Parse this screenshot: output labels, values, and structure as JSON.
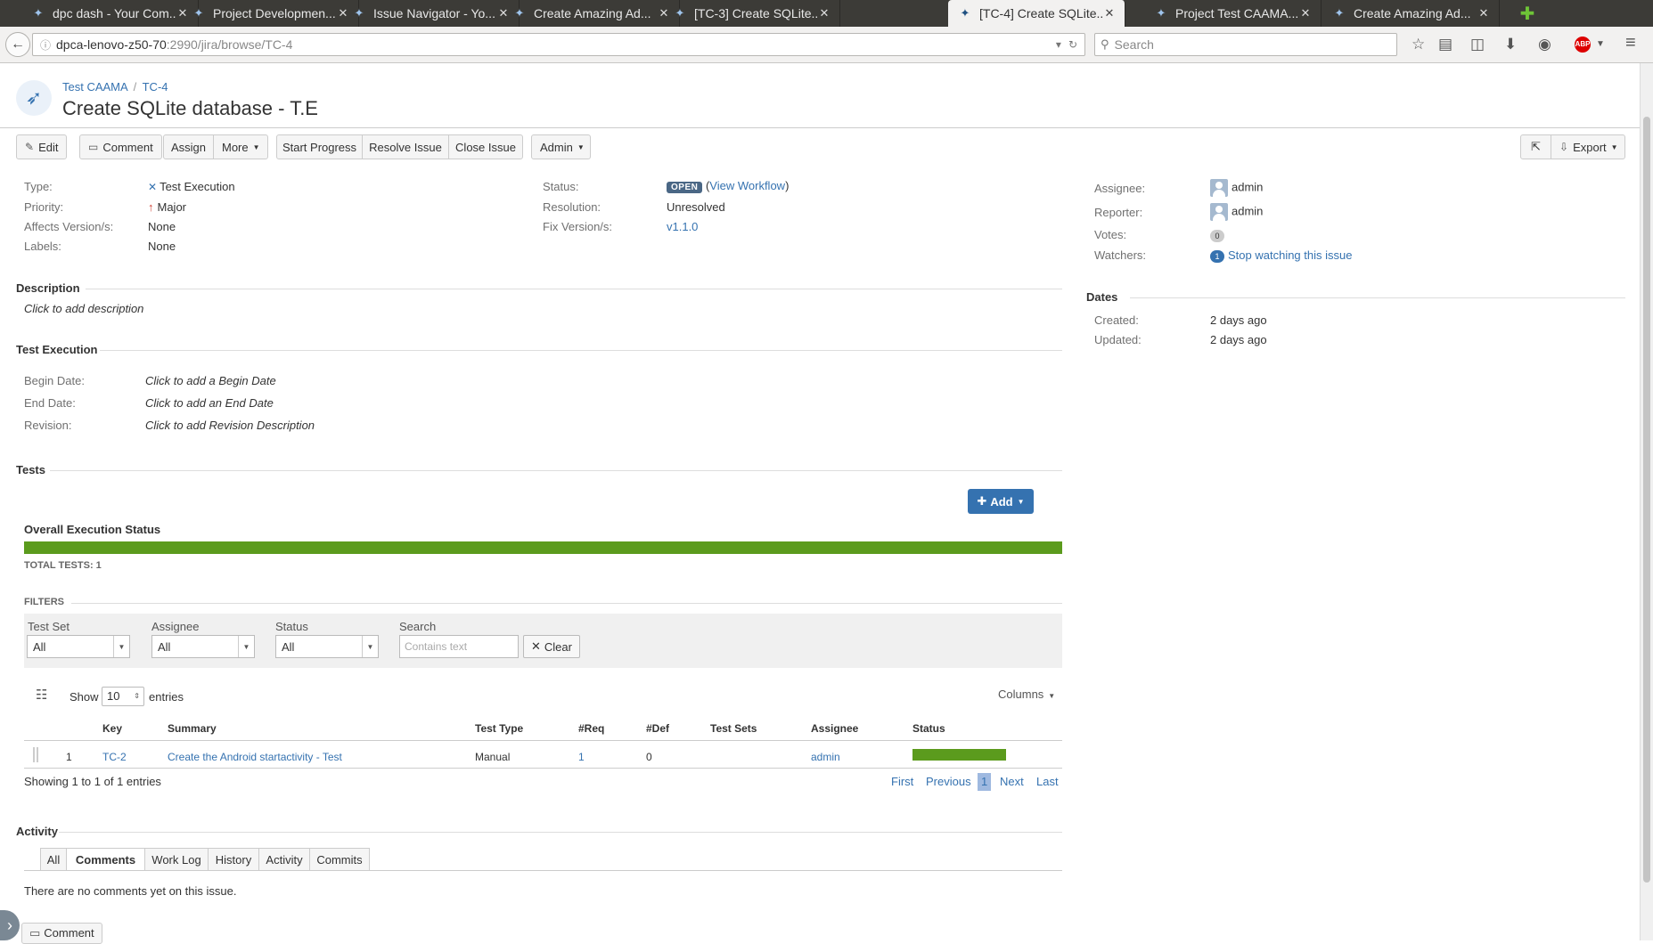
{
  "browser": {
    "tabs": [
      {
        "title": "dpc dash - Your Com..."
      },
      {
        "title": "Project Developmen..."
      },
      {
        "title": "Issue Navigator - Yo..."
      },
      {
        "title": "Create Amazing Ad..."
      },
      {
        "title": "[TC-3] Create SQLite..."
      },
      {
        "title": "[TC-4] Create SQLite...",
        "active": true
      },
      {
        "title": "Project Test CAAMA..."
      },
      {
        "title": "Create Amazing Ad..."
      }
    ],
    "url_host": "dpca-lenovo-z50-70",
    "url_path": ":2990/jira/browse/TC-4",
    "search_placeholder": "Search",
    "abp_label": "ABP"
  },
  "breadcrumb": {
    "project": "Test CAAMA",
    "separator": "/",
    "issue_key": "TC-4"
  },
  "issue": {
    "title": "Create SQLite database - T.E"
  },
  "toolbar": {
    "edit": "Edit",
    "comment": "Comment",
    "assign": "Assign",
    "more": "More",
    "start_progress": "Start Progress",
    "resolve": "Resolve Issue",
    "close": "Close Issue",
    "admin": "Admin",
    "export": "Export"
  },
  "details": {
    "type_label": "Type:",
    "type_value": "Test Execution",
    "priority_label": "Priority:",
    "priority_value": "Major",
    "affects_label": "Affects Version/s:",
    "affects_value": "None",
    "labels_label": "Labels:",
    "labels_value": "None",
    "status_label": "Status:",
    "status_value": "OPEN",
    "view_workflow": "View Workflow",
    "resolution_label": "Resolution:",
    "resolution_value": "Unresolved",
    "fix_label": "Fix Version/s:",
    "fix_value": "v1.1.0"
  },
  "people": {
    "assignee_label": "Assignee:",
    "assignee_value": "admin",
    "reporter_label": "Reporter:",
    "reporter_value": "admin",
    "votes_label": "Votes:",
    "votes_value": "0",
    "watchers_label": "Watchers:",
    "watchers_count": "1",
    "watch_link": "Stop watching this issue"
  },
  "dates": {
    "heading": "Dates",
    "created_label": "Created:",
    "created_value": "2 days ago",
    "updated_label": "Updated:",
    "updated_value": "2 days ago"
  },
  "description": {
    "heading": "Description",
    "placeholder": "Click to add description"
  },
  "test_execution": {
    "heading": "Test Execution",
    "begin_label": "Begin Date:",
    "begin_value": "Click to add a Begin Date",
    "end_label": "End Date:",
    "end_value": "Click to add an End Date",
    "revision_label": "Revision:",
    "revision_value": "Click to add Revision Description"
  },
  "tests": {
    "heading": "Tests",
    "add_button": "Add",
    "overall_status": "Overall Execution Status",
    "overall_pass_fraction": 1.0,
    "total_tests": "TOTAL TESTS: 1",
    "filters_heading": "FILTERS",
    "filters": {
      "test_set_label": "Test Set",
      "test_set_value": "All",
      "assignee_label": "Assignee",
      "assignee_value": "All",
      "status_label": "Status",
      "status_value": "All",
      "search_label": "Search",
      "search_placeholder": "Contains text",
      "clear": "Clear"
    },
    "show_label": "Show",
    "show_value": "10",
    "entries_label": "entries",
    "columns_button": "Columns",
    "columns": [
      "Key",
      "Summary",
      "Test Type",
      "#Req",
      "#Def",
      "Test Sets",
      "Assignee",
      "Status"
    ],
    "rows": [
      {
        "num": "1",
        "key": "TC-2",
        "summary": "Create the Android startactivity - Test",
        "test_type": "Manual",
        "req": "1",
        "def": "0",
        "test_sets": "",
        "assignee": "admin",
        "status_pass_fraction": 1.0
      }
    ],
    "showing": "Showing 1 to 1 of 1 entries",
    "pager": {
      "first": "First",
      "previous": "Previous",
      "current": "1",
      "next": "Next",
      "last": "Last"
    }
  },
  "activity": {
    "heading": "Activity",
    "tabs": [
      "All",
      "Comments",
      "Work Log",
      "History",
      "Activity",
      "Commits"
    ],
    "active_tab": "Comments",
    "empty_message": "There are no comments yet on this issue.",
    "comment_button": "Comment"
  },
  "colors": {
    "accent": "#3572b0",
    "success": "#5b9b1d",
    "lozenge": "#4a6785"
  }
}
